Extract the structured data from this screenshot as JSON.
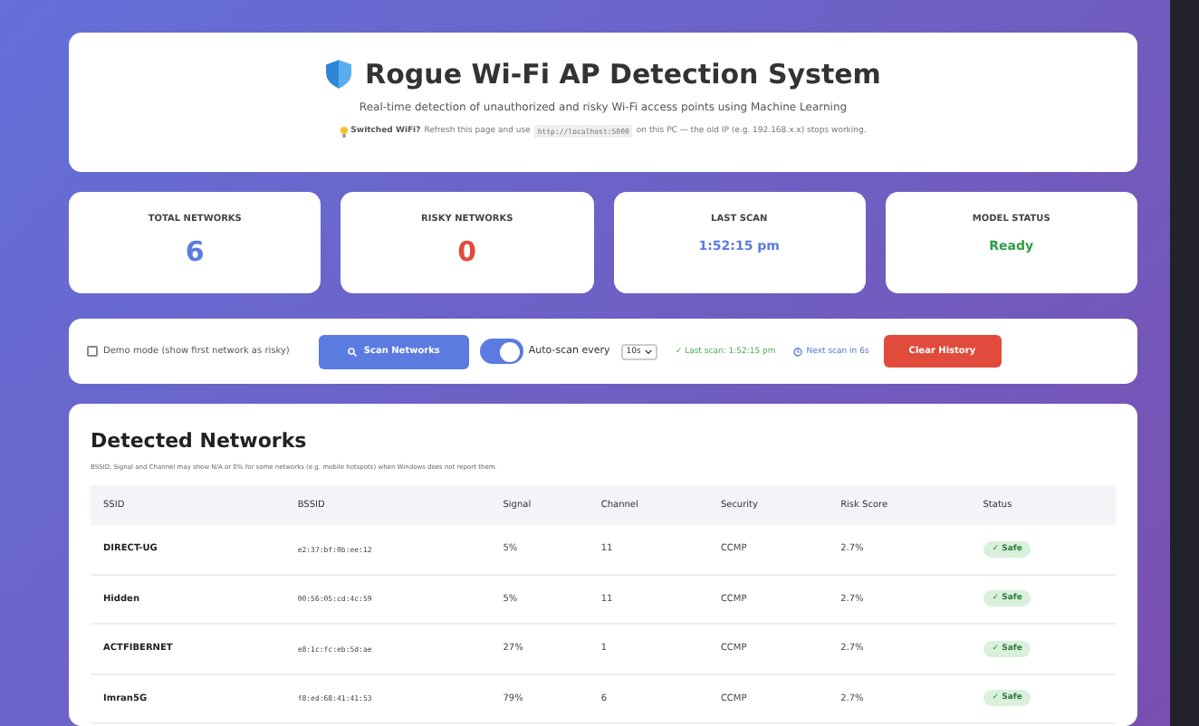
{
  "header": {
    "title": "Rogue Wi-Fi AP Detection System",
    "subtitle": "Real-time detection of unauthorized and risky Wi-Fi access points using Machine Learning",
    "notice": {
      "label": "Switched WiFi?",
      "before": "Refresh this page and use",
      "url": "http://localhost:5000",
      "after": "on this PC — the old IP (e.g. 192.168.x.x) stops working."
    }
  },
  "stats": [
    {
      "label": "TOTAL NETWORKS",
      "value": "6",
      "kind": "count",
      "color": "#5b7be0"
    },
    {
      "label": "RISKY NETWORKS",
      "value": "0",
      "kind": "count",
      "color": "#e04b3c"
    },
    {
      "label": "LAST SCAN",
      "value": "1:52:15 pm",
      "kind": "text",
      "color": "#5b7be0"
    },
    {
      "label": "MODEL STATUS",
      "value": "Ready",
      "kind": "text",
      "color": "#2e9d48"
    }
  ],
  "controls": {
    "demo_mode": {
      "label": "Demo mode (show first network as risky)",
      "checked": false
    },
    "scan_button": "Scan Networks",
    "auto_scan": {
      "on": true,
      "label": "Auto-scan every",
      "interval": "10s"
    },
    "last_scan": "✓ Last scan: 1:52:15 pm",
    "next_scan": "Next scan in 6s",
    "clear_button": "Clear History"
  },
  "table": {
    "title": "Detected Networks",
    "note": "BSSID, Signal and Channel may show N/A or 0% for some networks (e.g. mobile hotspots) when Windows does not report them.",
    "columns": [
      "SSID",
      "BSSID",
      "Signal",
      "Channel",
      "Security",
      "Risk Score",
      "Status"
    ],
    "rows": [
      {
        "ssid": "DIRECT-UG",
        "bssid": "e2:37:bf:0b:ee:12",
        "signal": "5%",
        "channel": "11",
        "security": "CCMP",
        "risk": "2.7%",
        "status": {
          "label": "✓ Safe",
          "kind": "safe"
        }
      },
      {
        "ssid": "Hidden",
        "bssid": "00:56:05:cd:4c:59",
        "signal": "5%",
        "channel": "11",
        "security": "CCMP",
        "risk": "2.7%",
        "status": {
          "label": "✓ Safe",
          "kind": "safe"
        }
      },
      {
        "ssid": "ACTFIBERNET",
        "bssid": "e8:1c:fc:eb:5d:ae",
        "signal": "27%",
        "channel": "1",
        "security": "CCMP",
        "risk": "2.7%",
        "status": {
          "label": "✓ Safe",
          "kind": "safe"
        }
      },
      {
        "ssid": "Imran5G",
        "bssid": "f8:ed:68:41:41:53",
        "signal": "79%",
        "channel": "6",
        "security": "CCMP",
        "risk": "2.7%",
        "status": {
          "label": "✓ Safe",
          "kind": "safe"
        }
      }
    ]
  }
}
